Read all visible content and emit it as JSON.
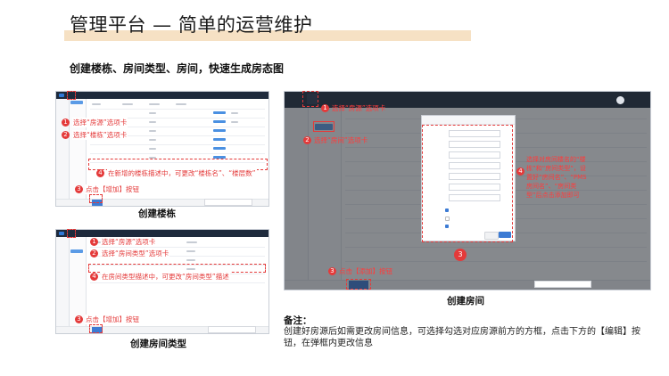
{
  "header": {
    "title": "管理平台 — 简单的运营维护",
    "subtitle": "创建楼栋、房间类型、房间，快速生成房态图"
  },
  "panels": {
    "building": {
      "caption": "创建楼栋",
      "steps": [
        {
          "num": "1",
          "text": "选择“房源”选项卡"
        },
        {
          "num": "2",
          "text": "选择“楼栋”选项卡"
        },
        {
          "num": "3",
          "text": "点击【增加】按钮"
        },
        {
          "num": "4",
          "text": "在新增的楼栋描述中，可更改“楼栋名”、“楼层数”"
        }
      ]
    },
    "room_type": {
      "caption": "创建房间类型",
      "steps": [
        {
          "num": "1",
          "text": "选择“房源”选项卡"
        },
        {
          "num": "2",
          "text": "选择“房间类型”选项卡"
        },
        {
          "num": "3",
          "text": "点击【增加】按钮"
        },
        {
          "num": "4",
          "text": "在房间类型描述中，可更改“房间类型”描述"
        }
      ]
    },
    "room": {
      "caption": "创建房间",
      "steps": [
        {
          "num": "1",
          "text": "选择“房源”选项卡"
        },
        {
          "num": "2",
          "text": "选择“房间”选项卡"
        },
        {
          "num": "3",
          "text": "点击【添加】按钮"
        },
        {
          "num": "3",
          "text": ""
        },
        {
          "num": "4",
          "text": "选择对房间楼名的“楼栋”和“房间类型”，设置好“房间名”、“PMS房间名”、“房间类型”后点击添加即可"
        }
      ]
    }
  },
  "note": {
    "title": "备注：",
    "body": "创建好房源后如需更改房间信息，可选择勾选对应房源前方的方框，点击下方的【编辑】按钮，在弹框内更改信息"
  },
  "colors": {
    "accent_red": "#e43a3a",
    "highlight_bar": "#f6e1c4",
    "app_topbar": "#1e2a3c",
    "app_blue": "#3c7bd4"
  }
}
